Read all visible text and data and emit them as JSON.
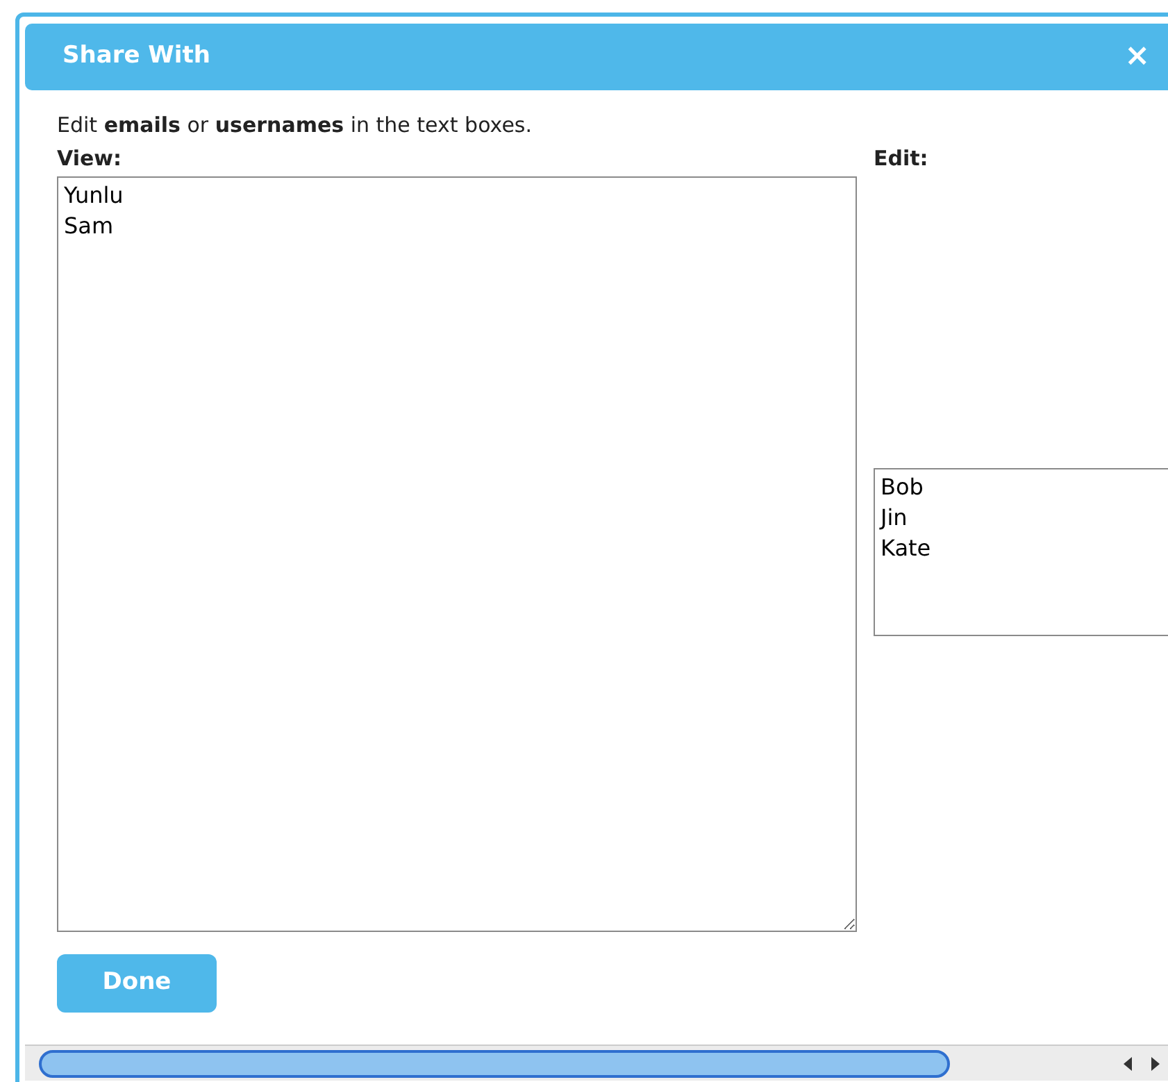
{
  "dialog": {
    "title": "Share With",
    "close": "×"
  },
  "instructions": "Edit **emails** or **usernames** in the text boxes.",
  "view": {
    "label": "View:",
    "entries": [
      "Yunlu",
      "Sam"
    ]
  },
  "edit": {
    "label": "Edit:",
    "entries": [
      "Bob",
      "Jin",
      "Kate"
    ]
  },
  "buttons": [
    "Done"
  ]
}
